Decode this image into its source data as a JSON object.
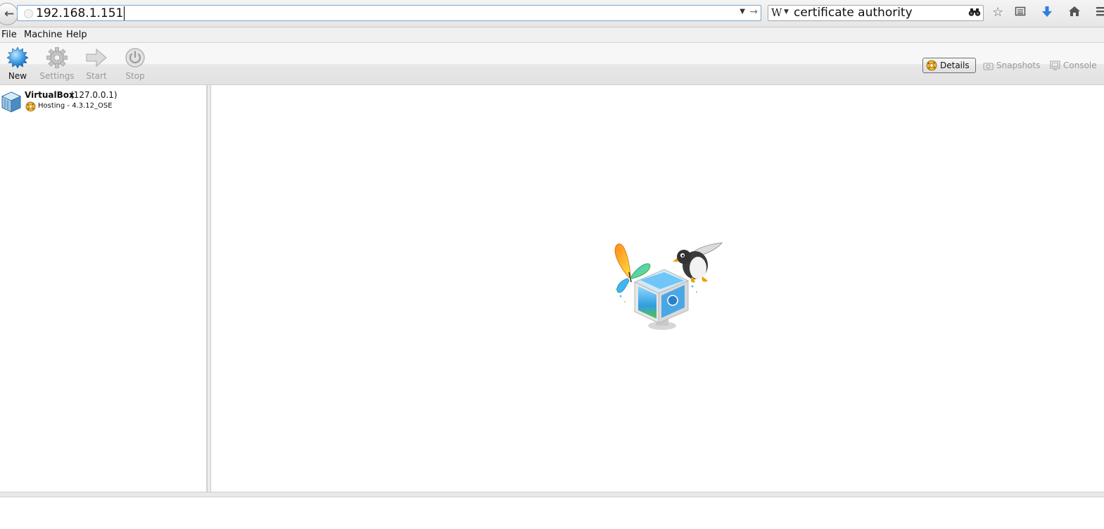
{
  "browser": {
    "url": "192.168.1.151",
    "search_engine_glyph": "W",
    "search_query": "certificate authority",
    "icons": [
      "back-arrow-icon",
      "globe-icon",
      "dropdown-arrow-icon",
      "go-arrow-icon",
      "binoculars-icon",
      "bookmark-star-icon",
      "reading-list-icon",
      "download-arrow-icon",
      "home-icon",
      "hamburger-menu-icon"
    ],
    "download_color": "#2f7fe0"
  },
  "menu": {
    "file": "File",
    "machine": "Machine",
    "help": "Help"
  },
  "toolbar": {
    "new": "New",
    "settings": "Settings",
    "start": "Start",
    "stop": "Stop",
    "details": "Details",
    "snapshots": "Snapshots",
    "console": "Console"
  },
  "vm_list": {
    "items": [
      {
        "name": "VirtualBox",
        "host": "(127.0.0.1)",
        "status": "Hosting - 4.3.12_OSE"
      }
    ]
  }
}
